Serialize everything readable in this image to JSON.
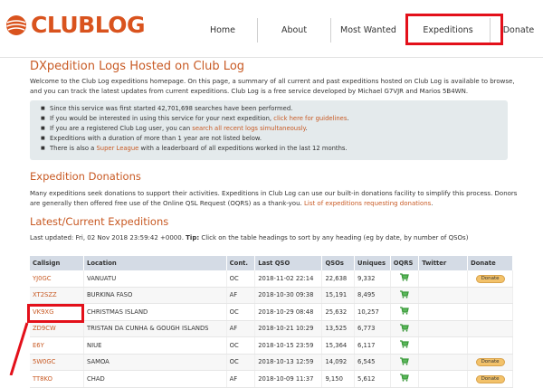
{
  "logo": {
    "text": "CLUBLOG"
  },
  "nav": {
    "items": [
      {
        "label": "Home",
        "width": 76
      },
      {
        "label": "About",
        "width": 80
      },
      {
        "label": "Most Wanted",
        "width": 82
      },
      {
        "label": "Expeditions",
        "width": 92
      },
      {
        "label": "Donate",
        "width": 62
      }
    ]
  },
  "page": {
    "title": "DXpedition Logs Hosted on Club Log",
    "intro": "Welcome to the Club Log expeditions homepage. On this page, a summary of all current and past expeditions hosted on Club Log is available to browse, and you can track the latest updates from current expeditions. Club Log is a free service developed by Michael G7VJR and Marios 5B4WN."
  },
  "info": {
    "line1": "Since this service was first started 42,701,698 searches have been performed.",
    "line2_pre": "If you would be interested in using this service for your next expedition, ",
    "line2_link": "click here for guidelines",
    "line2_post": ".",
    "line3_pre": "If you are a registered Club Log user, you can ",
    "line3_link": "search all recent logs simultaneously",
    "line3_post": ".",
    "line4": "Expeditions with a duration of more than 1 year are not listed below.",
    "line5_pre": "There is also a ",
    "line5_link": "Super League",
    "line5_post": " with a leaderboard of all expeditions worked in the last 12 months."
  },
  "donations": {
    "heading": "Expedition Donations",
    "text_pre": "Many expeditions seek donations to support their activities. Expeditions in Club Log can use our built-in donations facility to simplify this process. Donors are generally then offered free use of the Online QSL Request (OQRS) as a thank-you. ",
    "text_link": "List of expeditions requesting donations",
    "text_post": "."
  },
  "latest": {
    "heading": "Latest/Current Expeditions",
    "updated_prefix": "Last updated: Fri, 02 Nov 2018 23:59:42 +0000. ",
    "tip_label": "Tip:",
    "tip_text": " Click on the table headings to sort by any heading (eg by date, by number of QSOs)"
  },
  "table": {
    "headers": [
      "Callsign",
      "Location",
      "Cont.",
      "Last QSO",
      "QSOs",
      "Uniques",
      "OQRS",
      "Twitter",
      "Donate"
    ],
    "donate_label": "Donate",
    "rows": [
      {
        "call": "YJ0GC",
        "loc": "VANUATU",
        "cont": "OC",
        "last": "2018-11-02 22:14",
        "qsos": "22,638",
        "uniq": "9,332",
        "oqrs": true,
        "donate": true
      },
      {
        "call": "XT2SZZ",
        "loc": "BURKINA FASO",
        "cont": "AF",
        "last": "2018-10-30 09:38",
        "qsos": "15,191",
        "uniq": "8,495",
        "oqrs": true,
        "donate": false
      },
      {
        "call": "VK9XG",
        "loc": "CHRISTMAS ISLAND",
        "cont": "OC",
        "last": "2018-10-29 08:48",
        "qsos": "25,632",
        "uniq": "10,257",
        "oqrs": true,
        "donate": false
      },
      {
        "call": "ZD9CW",
        "loc": "TRISTAN DA CUNHA & GOUGH ISLANDS",
        "cont": "AF",
        "last": "2018-10-21 10:29",
        "qsos": "13,525",
        "uniq": "6,773",
        "oqrs": true,
        "donate": false
      },
      {
        "call": "E6Y",
        "loc": "NIUE",
        "cont": "OC",
        "last": "2018-10-15 23:59",
        "qsos": "15,364",
        "uniq": "6,117",
        "oqrs": true,
        "donate": false
      },
      {
        "call": "5W0GC",
        "loc": "SAMOA",
        "cont": "OC",
        "last": "2018-10-13 12:59",
        "qsos": "14,092",
        "uniq": "6,545",
        "oqrs": true,
        "donate": true
      },
      {
        "call": "TT8KO",
        "loc": "CHAD",
        "cont": "AF",
        "last": "2018-10-09 11:37",
        "qsos": "9,150",
        "uniq": "5,612",
        "oqrs": true,
        "donate": true
      }
    ]
  }
}
